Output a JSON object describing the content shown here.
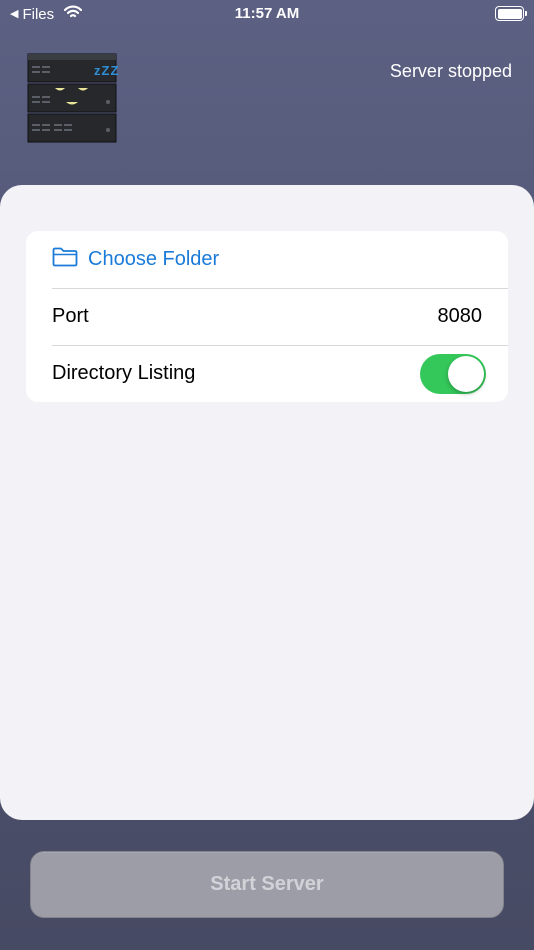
{
  "status_bar": {
    "back_label": "Files",
    "time": "11:57 AM",
    "battery_level": 1.0
  },
  "header": {
    "server_status": "Server stopped",
    "sleep_text": "zZZ"
  },
  "settings": {
    "choose_folder_label": "Choose Folder",
    "port_label": "Port",
    "port_value": "8080",
    "directory_listing_label": "Directory Listing",
    "directory_listing_enabled": true
  },
  "footer": {
    "start_button_label": "Start Server"
  },
  "colors": {
    "accent_blue": "#1b7bd8",
    "toggle_green": "#34c759",
    "background": "#515573",
    "sheet": "#f2f2f7"
  },
  "icons": [
    "back-arrow-icon",
    "wifi-icon",
    "battery-icon",
    "sleeping-server-icon",
    "folder-icon"
  ]
}
